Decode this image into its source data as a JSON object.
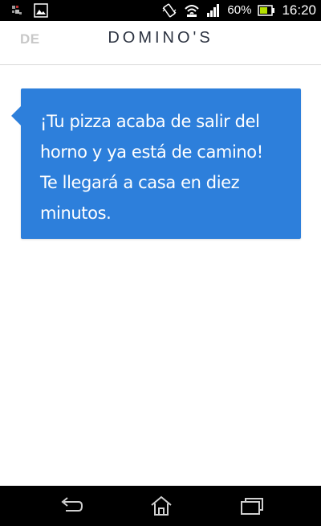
{
  "status_bar": {
    "battery_percent": "60%",
    "time": "16:20",
    "icons": [
      "notification-icon",
      "image-icon",
      "vibrate-icon",
      "wifi-icon",
      "signal-icon",
      "battery-icon"
    ]
  },
  "header": {
    "language_label": "DE",
    "brand": "DOMINO'S"
  },
  "message": {
    "lines": [
      "¡Tu pizza acaba de salir del",
      "horno y ya está de camino!",
      "Te llegará a casa en diez",
      "minutos."
    ]
  },
  "nav_bar": {
    "icons": [
      "back-icon",
      "home-icon",
      "recent-apps-icon"
    ]
  },
  "colors": {
    "bubble": "#2d7fdb",
    "brand_text": "#2b3240",
    "lang_text": "#c8c8c8",
    "battery": "#b4e000"
  }
}
